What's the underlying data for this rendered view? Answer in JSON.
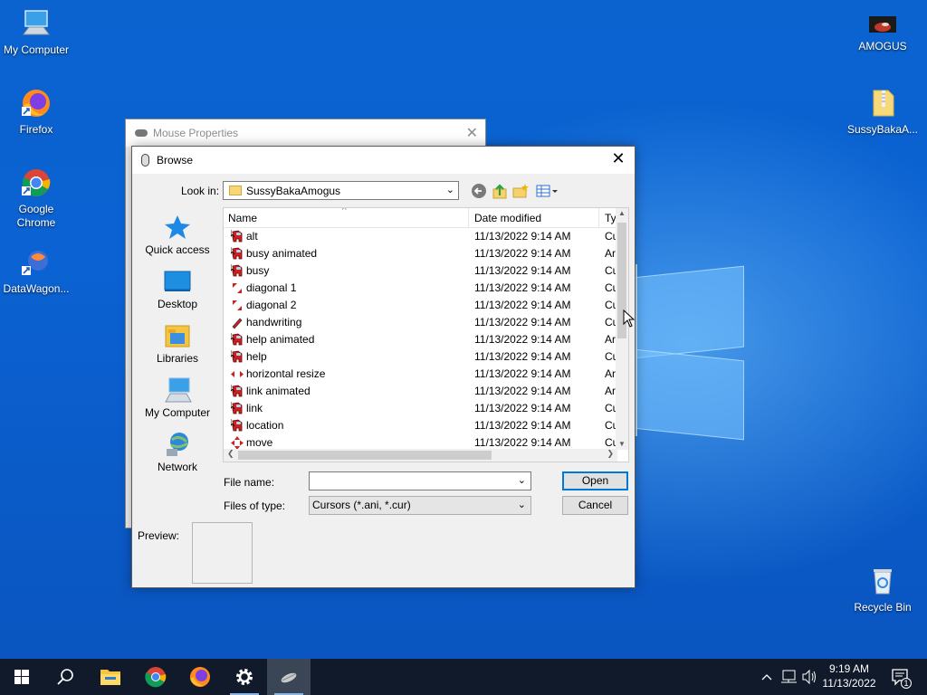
{
  "desktop": {
    "icons_left": [
      {
        "label": "My Computer"
      },
      {
        "label": "Firefox"
      },
      {
        "label": "Google Chrome"
      },
      {
        "label": "DataWagon..."
      }
    ],
    "icons_right": [
      {
        "label": "AMOGUS"
      },
      {
        "label": "SussyBakaA..."
      },
      {
        "label": "Recycle Bin"
      }
    ]
  },
  "mouse_properties": {
    "title": "Mouse Properties",
    "close_glyph": "✕"
  },
  "browse_dialog": {
    "title": "Browse",
    "close_glyph": "✕",
    "look_in_label": "Look in:",
    "look_in_value": "SussyBakaAmogus",
    "places": [
      {
        "label": "Quick access",
        "icon": "star-icon"
      },
      {
        "label": "Desktop",
        "icon": "desktop-icon"
      },
      {
        "label": "Libraries",
        "icon": "libraries-icon"
      },
      {
        "label": "My Computer",
        "icon": "computer-icon"
      },
      {
        "label": "Network",
        "icon": "network-icon"
      }
    ],
    "columns": {
      "name": "Name",
      "date": "Date modified",
      "type": "Ty"
    },
    "files": [
      {
        "name": "alt",
        "date": "11/13/2022 9:14 AM",
        "type": "Cu",
        "icon": "amogus-cursor-icon"
      },
      {
        "name": "busy animated",
        "date": "11/13/2022 9:14 AM",
        "type": "Ar",
        "icon": "amogus-cursor-icon"
      },
      {
        "name": "busy",
        "date": "11/13/2022 9:14 AM",
        "type": "Cu",
        "icon": "amogus-cursor-icon"
      },
      {
        "name": "diagonal 1",
        "date": "11/13/2022 9:14 AM",
        "type": "Cu",
        "icon": "diagonal-resize-icon"
      },
      {
        "name": "diagonal 2",
        "date": "11/13/2022 9:14 AM",
        "type": "Cu",
        "icon": "diagonal-resize-icon"
      },
      {
        "name": "handwriting",
        "date": "11/13/2022 9:14 AM",
        "type": "Cu",
        "icon": "pen-icon"
      },
      {
        "name": "help animated",
        "date": "11/13/2022 9:14 AM",
        "type": "Ar",
        "icon": "amogus-cursor-icon"
      },
      {
        "name": "help",
        "date": "11/13/2022 9:14 AM",
        "type": "Cu",
        "icon": "amogus-cursor-icon"
      },
      {
        "name": "horizontal resize",
        "date": "11/13/2022 9:14 AM",
        "type": "Ar",
        "icon": "horizontal-resize-icon"
      },
      {
        "name": "link animated",
        "date": "11/13/2022 9:14 AM",
        "type": "Ar",
        "icon": "amogus-cursor-icon"
      },
      {
        "name": "link",
        "date": "11/13/2022 9:14 AM",
        "type": "Cu",
        "icon": "amogus-cursor-icon"
      },
      {
        "name": "location",
        "date": "11/13/2022 9:14 AM",
        "type": "Cu",
        "icon": "amogus-cursor-icon"
      },
      {
        "name": "move",
        "date": "11/13/2022 9:14 AM",
        "type": "Cu",
        "icon": "move-icon"
      }
    ],
    "file_name_label": "File name:",
    "file_name_value": "",
    "files_of_type_label": "Files of type:",
    "files_of_type_value": "Cursors (*.ani, *.cur)",
    "open_label": "Open",
    "cancel_label": "Cancel",
    "preview_label": "Preview:"
  },
  "taskbar": {
    "time": "9:19 AM",
    "date": "11/13/2022",
    "notification_count": "1"
  },
  "colors": {
    "desktop_blue": "#0a63cf",
    "taskbar": "#101a2a",
    "accent": "#0078d7",
    "amogus_red": "#d01f1f"
  }
}
